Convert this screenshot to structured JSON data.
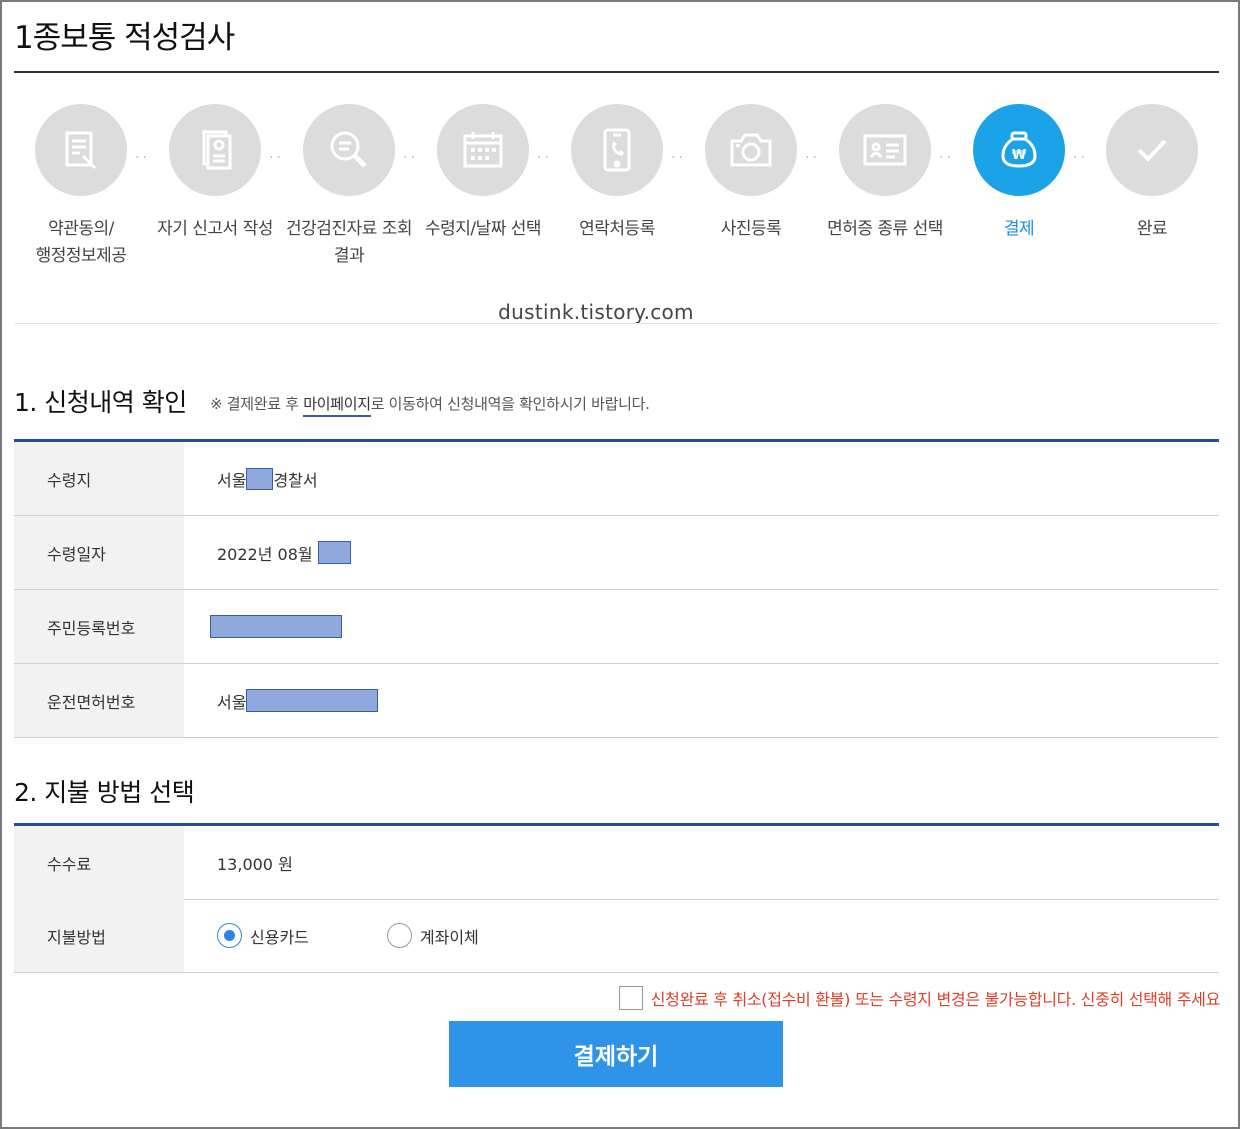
{
  "page_title": "1종보통 적성검사",
  "steps": [
    {
      "label_line1": "약관동의/",
      "label_line2": "행정정보제공",
      "icon": "document-edit-icon",
      "active": false
    },
    {
      "label_line1": "자기 신고서 작성",
      "label_line2": "",
      "icon": "id-document-icon",
      "active": false
    },
    {
      "label_line1": "건강검진자료 조회",
      "label_line2": "결과",
      "icon": "search-icon",
      "active": false
    },
    {
      "label_line1": "수령지/날짜 선택",
      "label_line2": "",
      "icon": "calendar-icon",
      "active": false
    },
    {
      "label_line1": "연락처등록",
      "label_line2": "",
      "icon": "phone-icon",
      "active": false
    },
    {
      "label_line1": "사진등록",
      "label_line2": "",
      "icon": "camera-icon",
      "active": false
    },
    {
      "label_line1": "면허증 종류 선택",
      "label_line2": "",
      "icon": "license-card-icon",
      "active": false
    },
    {
      "label_line1": "결제",
      "label_line2": "",
      "icon": "money-bag-icon",
      "active": true
    },
    {
      "label_line1": "완료",
      "label_line2": "",
      "icon": "check-icon",
      "active": false
    }
  ],
  "watermark": "dustink.tistory.com",
  "section1": {
    "title": "1. 신청내역 확인",
    "note_prefix": "※ 결제완료 후 ",
    "note_link": "마이페이지",
    "note_suffix": "로 이동하여 신청내역을 확인하시기 바랍니다.",
    "rows": [
      {
        "label": "수령지",
        "value_before": "서울",
        "value_after": "경찰서"
      },
      {
        "label": "수령일자",
        "value_before": "2022년 08월",
        "value_after": ""
      },
      {
        "label": "주민등록번호",
        "value_before": "",
        "value_after": ""
      },
      {
        "label": "운전면허번호",
        "value_before": "서울",
        "value_after": ""
      }
    ]
  },
  "section2": {
    "title": "2. 지불 방법 선택",
    "fee_label": "수수료",
    "fee_value": "13,000 원",
    "method_label": "지불방법",
    "methods": [
      {
        "label": "신용카드",
        "checked": true
      },
      {
        "label": "계좌이체",
        "checked": false
      }
    ]
  },
  "agreement_text": "신청완료 후 취소(접수비 환불) 또는 수령지 변경은 불가능합니다. 신중히 선택해 주세요",
  "pay_button": "결제하기",
  "colors": {
    "accent": "#1aa3e6",
    "button": "#2f93e8",
    "section_rule": "#254ca0",
    "warning": "#e0402a",
    "mask": "#8fa9dc"
  }
}
